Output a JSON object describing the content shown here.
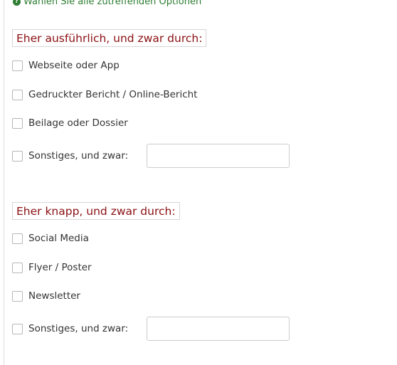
{
  "hint": {
    "icon": "help-circle-icon",
    "text": "Wählen Sie alle zutreffenden Optionen"
  },
  "groups": [
    {
      "title": "Eher ausführlich, und zwar durch:",
      "options": [
        {
          "label": "Webseite oder App",
          "checked": false
        },
        {
          "label": "Gedruckter Bericht / Online-Bericht",
          "checked": false
        },
        {
          "label": "Beilage oder Dossier",
          "checked": false
        },
        {
          "label": "Sonstiges, und zwar:",
          "checked": false
        }
      ],
      "other_value": ""
    },
    {
      "title": "Eher knapp, und zwar durch:",
      "options": [
        {
          "label": "Social Media",
          "checked": false
        },
        {
          "label": "Flyer / Poster",
          "checked": false
        },
        {
          "label": "Newsletter",
          "checked": false
        },
        {
          "label": "Sonstiges, und zwar:",
          "checked": false
        }
      ],
      "other_value": ""
    }
  ],
  "colors": {
    "hint": "#2e7d32",
    "section_title": "#8b0f12",
    "text": "#333333"
  }
}
